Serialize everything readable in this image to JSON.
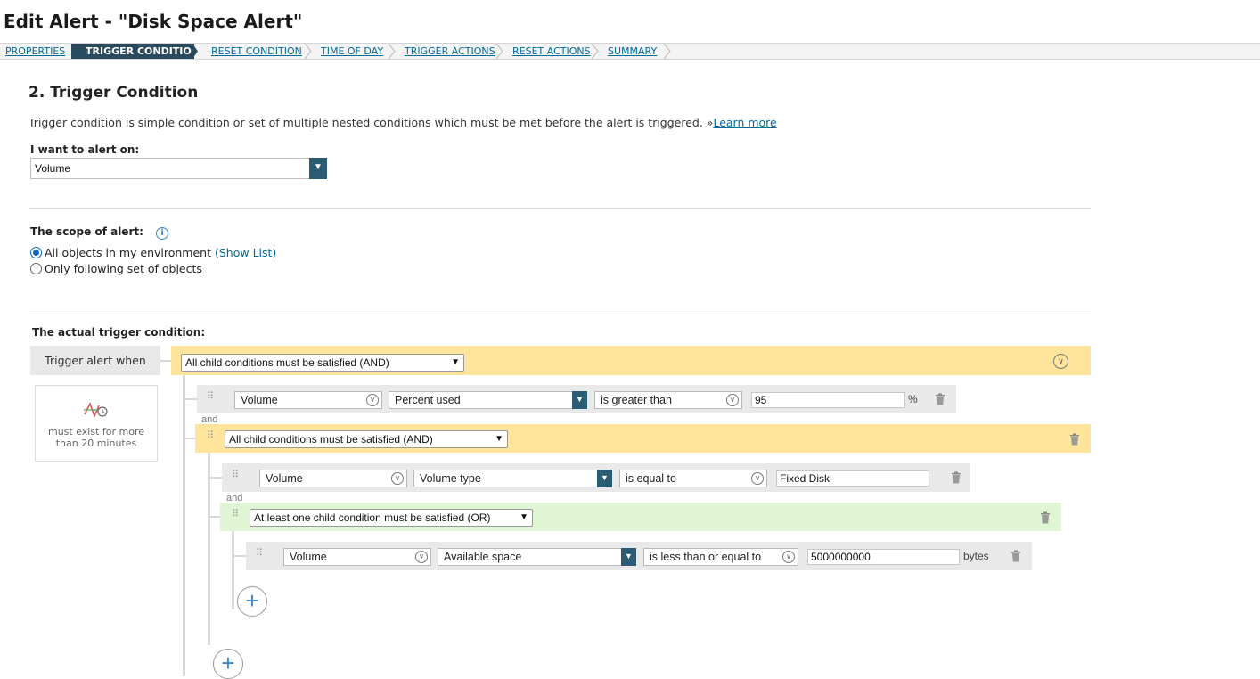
{
  "page": {
    "title": "Edit Alert - \"Disk Space Alert\""
  },
  "breadcrumb": [
    {
      "label": "PROPERTIES",
      "active": false
    },
    {
      "label": "TRIGGER CONDITION",
      "active": true
    },
    {
      "label": "RESET CONDITION",
      "active": false
    },
    {
      "label": "TIME OF DAY",
      "active": false
    },
    {
      "label": "TRIGGER ACTIONS",
      "active": false
    },
    {
      "label": "RESET ACTIONS",
      "active": false
    },
    {
      "label": "SUMMARY",
      "active": false
    }
  ],
  "section": {
    "title": "2. Trigger Condition",
    "description": "Trigger condition is simple condition or set of multiple nested conditions which must be met before the alert is triggered. »",
    "learn_more": "Learn more"
  },
  "alert_on": {
    "label": "I want to alert on:",
    "value": "Volume"
  },
  "scope": {
    "label": "The scope of alert:",
    "options": [
      {
        "label": "All objects in my environment",
        "link": "(Show List)",
        "selected": true
      },
      {
        "label": "Only following set of objects",
        "selected": false
      }
    ]
  },
  "condition": {
    "label": "The actual trigger condition:",
    "trigger_when": "Trigger alert when",
    "sustain_text": "must exist for more than 20 minutes",
    "root_group": "All child conditions must be satisfied (AND)",
    "and_label": "and",
    "rows": {
      "r1": {
        "object": "Volume",
        "field": "Percent used",
        "operator": "is greater than",
        "value": "95",
        "unit": "%"
      },
      "g1": "All child conditions must be satisfied (AND)",
      "r2": {
        "object": "Volume",
        "field": "Volume type",
        "operator": "is equal to",
        "value": "Fixed Disk"
      },
      "g2": "At least one child condition must be satisfied (OR)",
      "r3": {
        "object": "Volume",
        "field": "Available space",
        "operator": "is less than or equal to",
        "value": "5000000000",
        "unit": "bytes"
      }
    }
  },
  "colors": {
    "and_group": "#ffe49c",
    "or_group": "#dff5d3",
    "accent": "#2a5d74",
    "link": "#006b9c"
  }
}
